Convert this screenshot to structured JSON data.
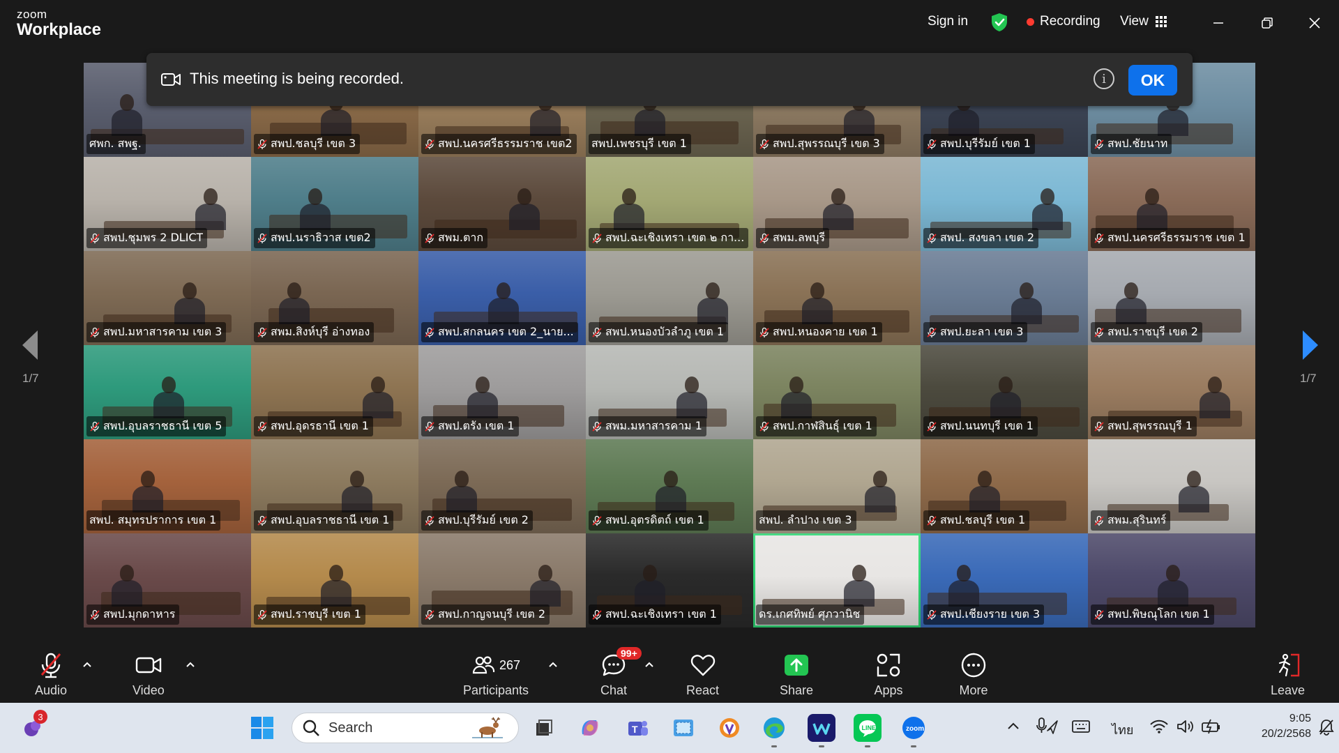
{
  "app": {
    "brand_small": "zoom",
    "brand_big": "Workplace"
  },
  "titlebar": {
    "sign_in": "Sign in",
    "recording": "Recording",
    "view": "View"
  },
  "banner": {
    "message": "This meeting is being recorded.",
    "ok": "OK",
    "info": "i"
  },
  "page": {
    "current": "1/7"
  },
  "tiles": [
    {
      "name": "ศพก. สพฐ.",
      "muted": false,
      "bg": "#5a5e6e"
    },
    {
      "name": "สพป.ชลบุรี เขต 3",
      "muted": true,
      "bg": "#8a6a48"
    },
    {
      "name": "สพป.นครศรีธรรมราช เขต2",
      "muted": true,
      "bg": "#9a7e5c"
    },
    {
      "name": "สพป.เพชรบุรี เขต 1",
      "muted": false,
      "bg": "#6b6450"
    },
    {
      "name": "สพป.สุพรรณบุรี เขต 3",
      "muted": true,
      "bg": "#8d7a62"
    },
    {
      "name": "สพป.บุรีรัมย์ เขต 1",
      "muted": true,
      "bg": "#3c4454"
    },
    {
      "name": "สพป.ชัยนาท",
      "muted": true,
      "bg": "#6e8ea2"
    },
    {
      "name": "สพป.ชุมพร 2 DLICT",
      "muted": true,
      "bg": "#b8b2aa"
    },
    {
      "name": "สพป.นราธิวาส เขต2",
      "muted": true,
      "bg": "#4f7e8a"
    },
    {
      "name": "สพม.ตาก",
      "muted": true,
      "bg": "#5c4a3c"
    },
    {
      "name": "สพป.ฉะเชิงเทรา เขต ๒ กา...",
      "muted": true,
      "bg": "#a3a874"
    },
    {
      "name": "สพม.ลพบุรี",
      "muted": true,
      "bg": "#a89888"
    },
    {
      "name": "สพป. สงขลา เขต 2",
      "muted": true,
      "bg": "#7cb8d4"
    },
    {
      "name": "สพป.นครศรีธรรมราช เขต 1",
      "muted": true,
      "bg": "#8a6b58"
    },
    {
      "name": "สพป.มหาสารคาม เขต 3",
      "muted": true,
      "bg": "#7e6a54"
    },
    {
      "name": "สพม.สิงห์บุรี อ่างทอง",
      "muted": true,
      "bg": "#7a6652"
    },
    {
      "name": "สพป.สกลนคร เขต 2_นาย...",
      "muted": true,
      "bg": "#3a5ea8"
    },
    {
      "name": "สพป.หนองบัวลำภู เขต 1",
      "muted": true,
      "bg": "#9c9a92"
    },
    {
      "name": "สพป.หนองคาย เขต 1",
      "muted": true,
      "bg": "#8a7256"
    },
    {
      "name": "สพป.ยะลา เขต 3",
      "muted": true,
      "bg": "#6a7c94"
    },
    {
      "name": "สพป.ราชบุรี เขต 2",
      "muted": true,
      "bg": "#a6aab0"
    },
    {
      "name": "สพป.อุบลราชธานี เขต 5",
      "muted": true,
      "bg": "#2e9a7c"
    },
    {
      "name": "สพป.อุดรธานี เขต 1",
      "muted": true,
      "bg": "#8e7452"
    },
    {
      "name": "สพป.ตรัง เขต 1",
      "muted": true,
      "bg": "#9e9c9c"
    },
    {
      "name": "สพม.มหาสารคาม 1",
      "muted": true,
      "bg": "#b6b8b4"
    },
    {
      "name": "สพป.กาฬสินธุ์ เขต 1",
      "muted": true,
      "bg": "#7c8460"
    },
    {
      "name": "สพป.นนทบุรี เขต 1",
      "muted": true,
      "bg": "#4c4a3e"
    },
    {
      "name": "สพป.สุพรรณบุรี 1",
      "muted": true,
      "bg": "#9a7c60"
    },
    {
      "name": "สพป. สมุทรปราการ เขต 1",
      "muted": false,
      "bg": "#a4623c"
    },
    {
      "name": "สพป.อุบลราชธานี เขต 1",
      "muted": true,
      "bg": "#8c7a5e"
    },
    {
      "name": "สพป.บุรีรัมย์ เขต 2",
      "muted": true,
      "bg": "#7c6a56"
    },
    {
      "name": "สพป.อุตรดิตถ์ เขต 1",
      "muted": true,
      "bg": "#5e7a54"
    },
    {
      "name": "สพป. ลำปาง เขต 3",
      "muted": false,
      "bg": "#b0a690"
    },
    {
      "name": "สพป.ชลบุรี เขต 1",
      "muted": true,
      "bg": "#8e6a4a"
    },
    {
      "name": "สพม.สุรินทร์",
      "muted": true,
      "bg": "#c8c6c2"
    },
    {
      "name": "สพป.มุกดาหาร",
      "muted": true,
      "bg": "#6a4a4a"
    },
    {
      "name": "สพป.ราชบุรี เขต 1",
      "muted": true,
      "bg": "#b48a4c"
    },
    {
      "name": "สพป.กาญจนบุรี เขต 2",
      "muted": true,
      "bg": "#8a7a6a"
    },
    {
      "name": "สพป.ฉะเชิงเทรา เขต 1",
      "muted": true,
      "bg": "#2a2a2a"
    },
    {
      "name": "ดร.เกศทิพย์ ศุภวานิช",
      "muted": false,
      "bg": "#e8e6e4",
      "active": true
    },
    {
      "name": "สพป.เชียงราย เขต 3",
      "muted": true,
      "bg": "#3a6ab8"
    },
    {
      "name": "สพป.พิษณุโลก เขต 1",
      "muted": true,
      "bg": "#4e4a6a"
    }
  ],
  "toolbar": {
    "audio": "Audio",
    "video": "Video",
    "participants": "Participants",
    "participants_count": "267",
    "chat": "Chat",
    "chat_badge": "99+",
    "react": "React",
    "share": "Share",
    "apps": "Apps",
    "more": "More",
    "leave": "Leave"
  },
  "taskbar": {
    "search": "Search",
    "notif_badge": "3",
    "lang": "ไทย",
    "time": "9:05",
    "date": "20/2/2568"
  },
  "colors": {
    "accent_blue": "#0e71eb",
    "share_green": "#23c552",
    "rec_red": "#ff3b30",
    "active_border": "#2ed573"
  }
}
